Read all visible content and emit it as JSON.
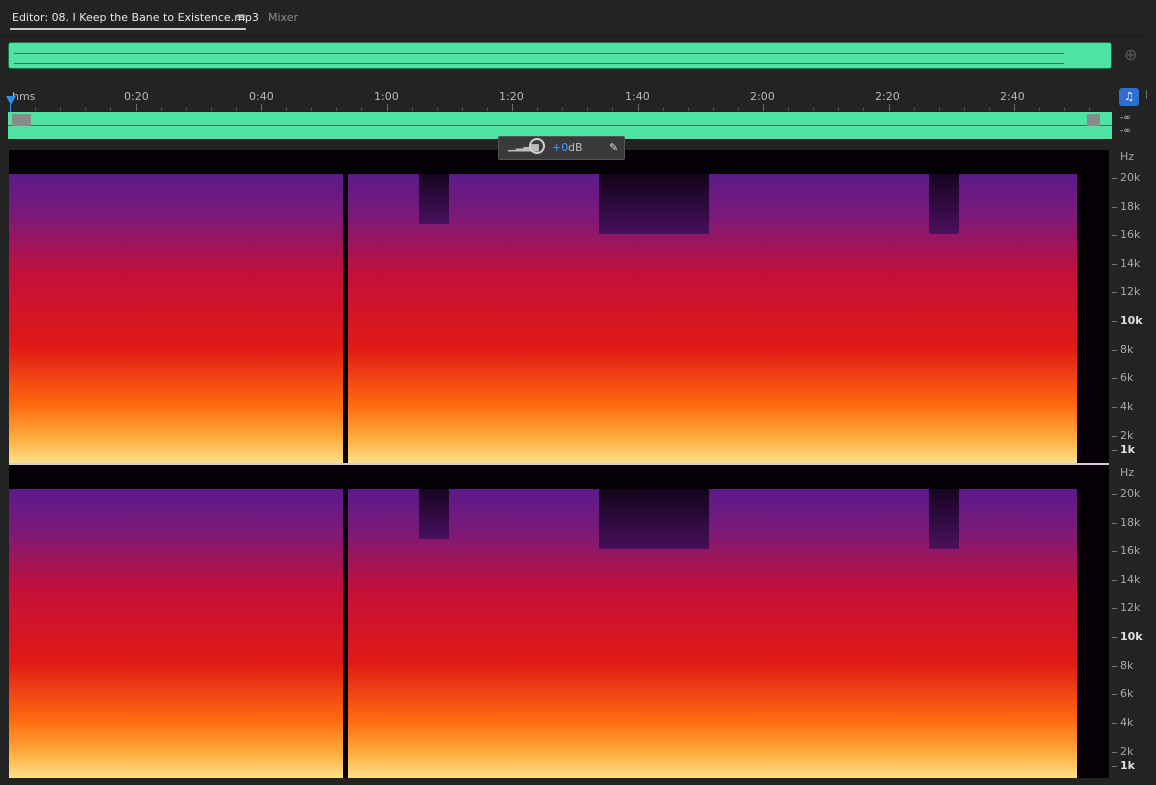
{
  "tabs": {
    "editor_label": "Editor: 08. I Keep the Bane to Existence.mp3",
    "editor_menu_glyph": "≡",
    "mixer_label": "Mixer"
  },
  "ruler": {
    "unit": "hms",
    "labels": [
      "0:20",
      "0:40",
      "1:00",
      "1:20",
      "1:40",
      "2:00",
      "2:20",
      "2:40"
    ]
  },
  "levels": {
    "left": "-∞",
    "right": "-∞"
  },
  "hud": {
    "value": "+0",
    "unit": "dB"
  },
  "freq_axis": {
    "unit": "Hz",
    "labels": [
      "20k",
      "18k",
      "16k",
      "14k",
      "12k",
      "10k",
      "8k",
      "6k",
      "4k",
      "2k",
      "1k"
    ]
  },
  "icons": {
    "zoom": "zoom-icon",
    "headphone": "headphone-icon",
    "pin": "pin-icon"
  },
  "colors": {
    "waveform": "#4fe3a3",
    "accent": "#2f8ff0"
  }
}
